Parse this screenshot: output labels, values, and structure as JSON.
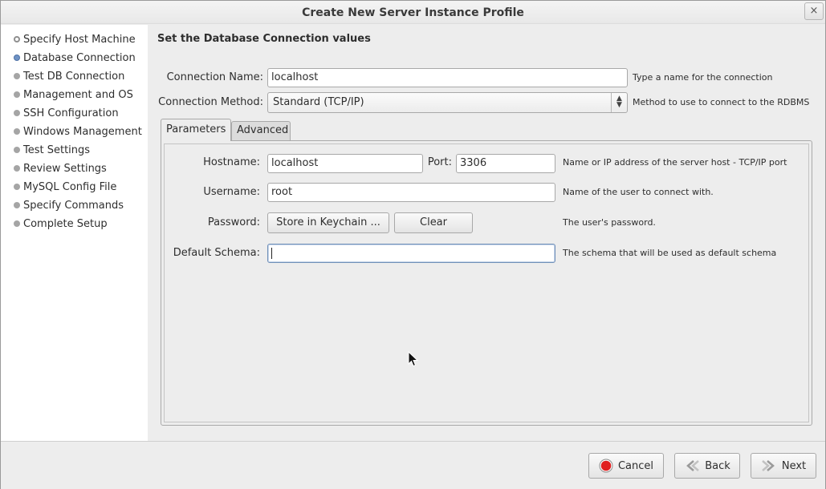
{
  "window": {
    "title": "Create New Server Instance Profile",
    "close_glyph": "×"
  },
  "sidebar": {
    "steps": [
      {
        "label": "Specify Host Machine",
        "state": "done"
      },
      {
        "label": "Database Connection",
        "state": "current"
      },
      {
        "label": "Test DB Connection",
        "state": "pending"
      },
      {
        "label": "Management and OS",
        "state": "pending"
      },
      {
        "label": "SSH Configuration",
        "state": "pending"
      },
      {
        "label": "Windows Management",
        "state": "pending"
      },
      {
        "label": "Test Settings",
        "state": "pending"
      },
      {
        "label": "Review Settings",
        "state": "pending"
      },
      {
        "label": "MySQL Config File",
        "state": "pending"
      },
      {
        "label": "Specify Commands",
        "state": "pending"
      },
      {
        "label": "Complete Setup",
        "state": "pending"
      }
    ]
  },
  "main": {
    "heading": "Set the Database Connection values",
    "connection_name": {
      "label": "Connection Name:",
      "value": "localhost",
      "hint": "Type a name for the connection"
    },
    "connection_method": {
      "label": "Connection Method:",
      "value": "Standard (TCP/IP)",
      "hint": "Method to use to connect to the RDBMS"
    },
    "tabs": [
      {
        "label": "Parameters",
        "active": true
      },
      {
        "label": "Advanced",
        "active": false
      }
    ],
    "parameters": {
      "hostname": {
        "label": "Hostname:",
        "value": "localhost"
      },
      "port": {
        "label": "Port:",
        "value": "3306"
      },
      "host_hint": "Name or IP address of the server host - TCP/IP port",
      "username": {
        "label": "Username:",
        "value": "root",
        "hint": "Name of the user to connect with."
      },
      "password": {
        "label": "Password:",
        "store_button": "Store in Keychain ...",
        "clear_button": "Clear",
        "hint": "The user's password."
      },
      "default_schema": {
        "label": "Default Schema:",
        "value": "",
        "hint": "The schema that will be used as default schema"
      }
    }
  },
  "footer": {
    "cancel_label": "Cancel",
    "back_label": "Back",
    "next_label": "Next"
  },
  "colors": {
    "cancel_icon": "#e02020",
    "current_step_dot": "#6f93c5"
  },
  "icons": {
    "close": "close-icon",
    "cancel": "stop-icon",
    "back": "back-arrow-icon",
    "next": "next-arrow-icon"
  }
}
